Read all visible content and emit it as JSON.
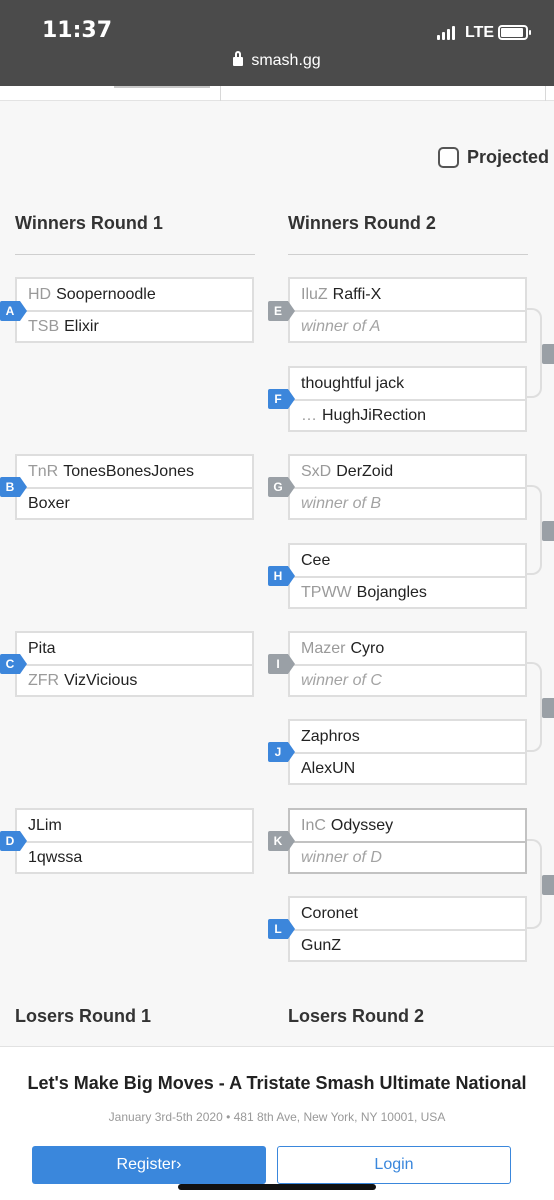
{
  "status_bar": {
    "time": "11:37",
    "network": "LTE",
    "url": "smash.gg"
  },
  "projected_label": "Projected",
  "rounds": [
    {
      "title": "Winners Round 1"
    },
    {
      "title": "Winners Round 2"
    },
    {
      "title": "Losers Round 1"
    },
    {
      "title": "Losers Round 2"
    }
  ],
  "matches": [
    {
      "id": "A",
      "badge_color": "blue",
      "p1_prefix": "HD",
      "p1_name": "Soopernoodle",
      "p2_prefix": "TSB",
      "p2_name": "Elixir"
    },
    {
      "id": "B",
      "badge_color": "blue",
      "p1_prefix": "TnR",
      "p1_name": "TonesBonesJones",
      "p2_prefix": "",
      "p2_name": "Boxer"
    },
    {
      "id": "C",
      "badge_color": "blue",
      "p1_prefix": "",
      "p1_name": "Pita",
      "p2_prefix": "ZFR",
      "p2_name": "VizVicious"
    },
    {
      "id": "D",
      "badge_color": "blue",
      "p1_prefix": "",
      "p1_name": "JLim",
      "p2_prefix": "",
      "p2_name": "1qwssa"
    },
    {
      "id": "E",
      "badge_color": "gray",
      "p1_prefix": "IluZ",
      "p1_name": "Raffi-X",
      "p2_placeholder": "winner of A"
    },
    {
      "id": "F",
      "badge_color": "blue",
      "p1_prefix": "",
      "p1_name": "thoughtful jack",
      "p2_prefix": "…",
      "p2_name": "HughJiRection"
    },
    {
      "id": "G",
      "badge_color": "gray",
      "p1_prefix": "SxD",
      "p1_name": "DerZoid",
      "p2_placeholder": "winner of B"
    },
    {
      "id": "H",
      "badge_color": "blue",
      "p1_prefix": "",
      "p1_name": "Cee",
      "p2_prefix": "TPWW",
      "p2_name": "Bojangles"
    },
    {
      "id": "I",
      "badge_color": "gray",
      "p1_prefix": "Mazer",
      "p1_name": "Cyro",
      "p2_placeholder": "winner of C"
    },
    {
      "id": "J",
      "badge_color": "blue",
      "p1_prefix": "",
      "p1_name": "Zaphros",
      "p2_prefix": "",
      "p2_name": "AlexUN"
    },
    {
      "id": "K",
      "badge_color": "gray",
      "p1_prefix": "InC",
      "p1_name": "Odyssey",
      "p2_placeholder": "winner of D"
    },
    {
      "id": "L",
      "badge_color": "blue",
      "p1_prefix": "",
      "p1_name": "Coronet",
      "p2_prefix": "",
      "p2_name": "GunZ"
    }
  ],
  "event": {
    "title": "Let's Make Big Moves - A Tristate Smash Ultimate National",
    "info": "January 3rd-5th 2020 • 481 8th Ave, New York, NY 10001, USA",
    "register_label": "Register›",
    "login_label": "Login"
  },
  "colors": {
    "accent": "#3a87dc",
    "badge_gray": "#9aa0a6",
    "status_bar": "#4b4b4b"
  }
}
